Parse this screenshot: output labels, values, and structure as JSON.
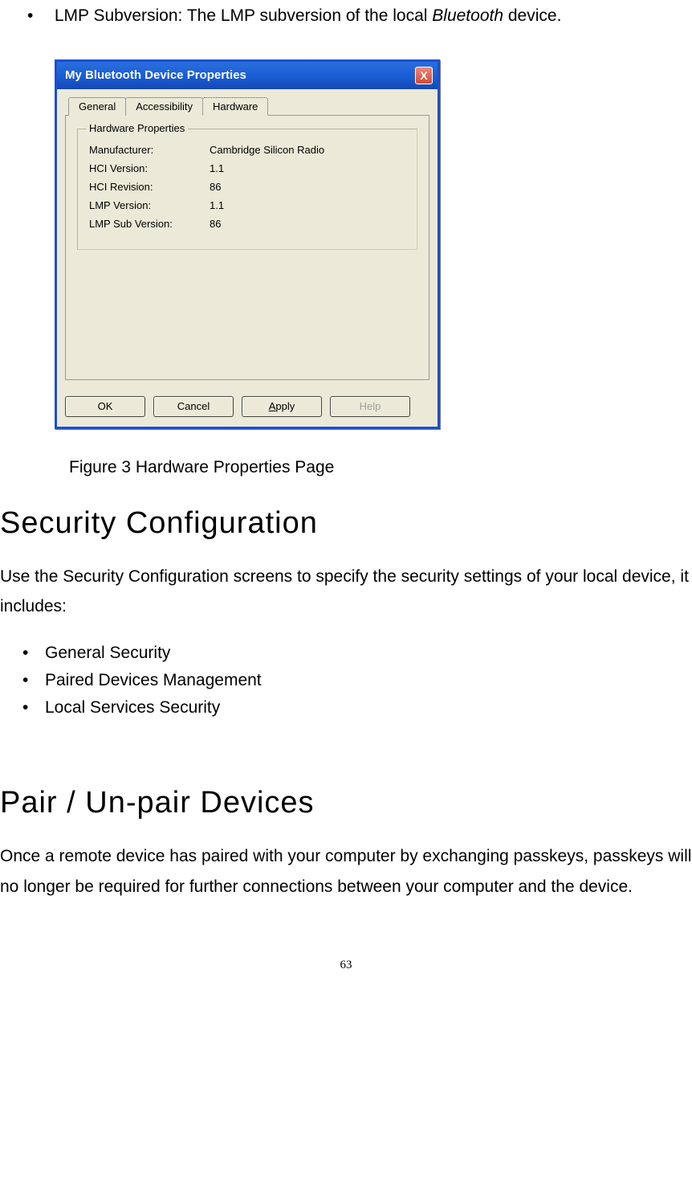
{
  "intro_bullet": {
    "prefix": "LMP Subversion: The LMP subversion of the local ",
    "italic": "Bluetooth",
    "suffix": " device."
  },
  "dialog": {
    "title": "My Bluetooth Device Properties",
    "close": "X",
    "tabs": {
      "general": "General",
      "accessibility": "Accessibility",
      "hardware": "Hardware"
    },
    "groupbox_legend": "Hardware Properties",
    "props": [
      {
        "label": "Manufacturer:",
        "value": "Cambridge Silicon Radio"
      },
      {
        "label": "HCI Version:",
        "value": "1.1"
      },
      {
        "label": "HCI Revision:",
        "value": "86"
      },
      {
        "label": "LMP Version:",
        "value": "1.1"
      },
      {
        "label": "LMP Sub Version:",
        "value": "86"
      }
    ],
    "buttons": {
      "ok": "OK",
      "cancel": "Cancel",
      "apply": "Apply",
      "help": "Help"
    }
  },
  "figure_caption": "Figure 3 Hardware Properties Page",
  "h1_security": "Security Configuration",
  "security_para": "Use the Security Configuration screens to specify the security settings of your local device, it includes:",
  "security_list": [
    "General Security",
    "Paired Devices Management",
    "Local Services Security"
  ],
  "h1_pair": "Pair / Un-pair Devices",
  "pair_para": "Once a remote device has paired with your computer by exchanging passkeys, passkeys will no longer be required for further connections between your computer and the device.",
  "page_number": "63"
}
